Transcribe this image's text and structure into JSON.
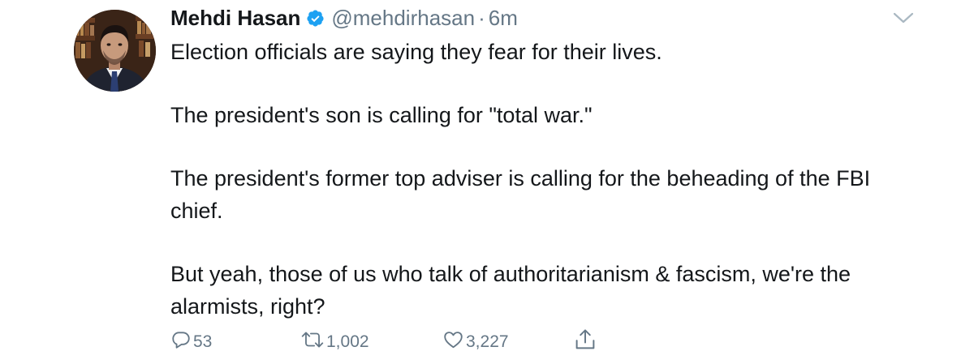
{
  "tweet": {
    "author_name": "Mehdi Hasan",
    "handle": "@mehdirhasan",
    "separator": "·",
    "time": "6m",
    "paragraphs": [
      "Election officials are saying they fear for their lives.",
      "The president's son is calling for \"total war.\"",
      "The president's former top adviser is calling for the beheading of the FBI chief.",
      "But yeah, those of us who talk of authoritarianism & fascism, we're the alarmists, right?"
    ]
  },
  "actions": {
    "reply_count": "53",
    "retweet_count": "1,002",
    "like_count": "3,227"
  },
  "icons": {
    "verified": "verified-badge-icon",
    "caret": "chevron-down-icon",
    "reply": "reply-icon",
    "retweet": "retweet-icon",
    "like": "heart-icon",
    "share": "share-icon"
  },
  "colors": {
    "text": "#14171a",
    "secondary": "#657786",
    "verified": "#1da1f2",
    "caret": "#aab8c2"
  }
}
